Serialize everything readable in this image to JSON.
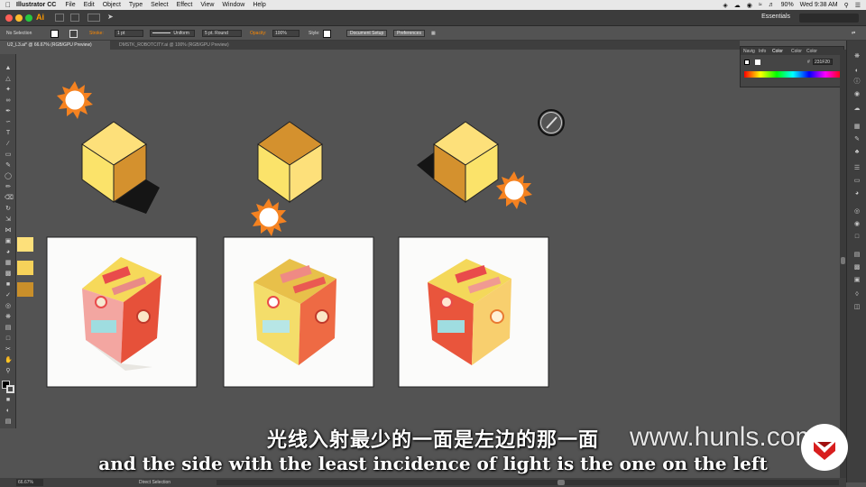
{
  "menubar": {
    "apple_icon": "apple-icon",
    "app_name": "Illustrator CC",
    "items": [
      "File",
      "Edit",
      "Object",
      "Type",
      "Select",
      "Effect",
      "View",
      "Window",
      "Help"
    ],
    "battery": "90%",
    "clock": "Wed 9:38 AM"
  },
  "appbar": {
    "logo": "Ai",
    "workspace": "Essentials"
  },
  "control": {
    "selection": "No Selection",
    "stroke_label": "Stroke:",
    "stroke_weight": "1 pt",
    "profile": "Uniform",
    "brush": "5 pt. Round",
    "opacity_label": "Opacity:",
    "opacity_value": "100%",
    "style_label": "Style:",
    "doc_setup": "Document Setup",
    "preferences": "Preferences"
  },
  "tabs": [
    {
      "label": "U2_L3.ai* @ 66.67% (RGB/GPU Preview)",
      "active": true
    },
    {
      "label": "DMSTK_ROBOTCITY.ai @ 100% (RGB/GPU Preview)",
      "active": false
    }
  ],
  "color_panel": {
    "tabs": [
      "Navig",
      "Info",
      "Color",
      "Color",
      "Color"
    ],
    "hex_prefix": "#",
    "hex_value": "231F20"
  },
  "swatches": {
    "top": "#fde07a",
    "right": "#d4912e",
    "left": "#fbe36a",
    "chips": [
      "#fde07a",
      "#f6d25a",
      "#c98f2a"
    ]
  },
  "status": {
    "zoom": "66.67%",
    "tool": "Direct Selection"
  },
  "subtitles": {
    "chinese": "光线入射最少的一面是左边的那一面",
    "english": "and the side with the least incidence of light is the one on the left"
  },
  "watermark": "www.hunls.com"
}
